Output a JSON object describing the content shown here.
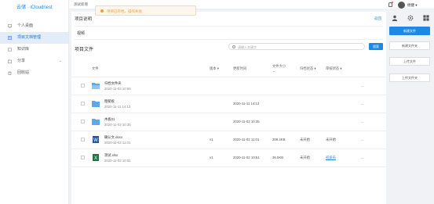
{
  "app": {
    "logo": "云储 · iCloudnest"
  },
  "sidebar": {
    "items": [
      {
        "label": "个人桌面",
        "icon": "desktop-icon",
        "active": false
      },
      {
        "label": "项目文档管理",
        "icon": "document-icon",
        "active": true
      },
      {
        "label": "知识库",
        "icon": "book-icon",
        "active": false
      },
      {
        "label": "分享",
        "icon": "share-icon",
        "active": false,
        "has_children": true
      },
      {
        "label": "回收站",
        "icon": "trash-icon",
        "active": false
      }
    ]
  },
  "header": {
    "breadcrumb": "测试新增",
    "username": "杨健",
    "toast": "项目已存档，操作失败"
  },
  "main": {
    "section_title": "项目说明",
    "back_label": "返回",
    "description": "视频",
    "files_title": "项目文件",
    "search_placeholder": "请输入关键字",
    "search_button": "搜索",
    "columns": [
      "文件",
      "版本",
      "更新时间",
      "文件大小",
      "归档状态",
      "审核状态"
    ],
    "rows": [
      {
        "type": "folder-open",
        "name": "归档文件夹",
        "date": "2020-11-02 10:59",
        "version": "",
        "updated": "",
        "size": "",
        "archive": "",
        "review": "",
        "review_link": false,
        "more": "..."
      },
      {
        "type": "folder",
        "name": "粗糙板",
        "date": "2020-11-11 14:13",
        "version": "",
        "updated": "2020-11-11 14:13",
        "size": "",
        "archive": "",
        "review": "",
        "review_link": false,
        "more": "..."
      },
      {
        "type": "folder",
        "name": "木板01",
        "date": "2020-11-02 10:35",
        "version": "",
        "updated": "2020-11-02 10:35",
        "size": "",
        "archive": "",
        "review": "",
        "review_link": false,
        "more": "..."
      },
      {
        "type": "word",
        "name": "确认文.docx",
        "date": "2020-11-02 11:01",
        "version": "v1",
        "updated": "2020-11-02 11:01",
        "size": "209.4KB",
        "archive": "未开始",
        "review": "未开始",
        "review_link": false,
        "more": "..."
      },
      {
        "type": "excel",
        "name": "测试.xlsx",
        "date": "2020-11-02 10:51",
        "version": "v1",
        "updated": "2020-11-02 10:51",
        "size": "36.5KB",
        "archive": "未开始",
        "review": "初发布",
        "review_link": true,
        "more": "..."
      }
    ]
  },
  "actions": {
    "new_file": "新建文件",
    "new_folder": "新建文件夹",
    "upload_file": "上传文件",
    "upload_folder": "上传文件夹"
  },
  "colors": {
    "accent": "#1e88e5",
    "active_bg": "#e3edf9",
    "toast_text": "#e6a23c",
    "word": "#2b579a",
    "excel": "#217346",
    "folder": "#5aa9f0"
  }
}
